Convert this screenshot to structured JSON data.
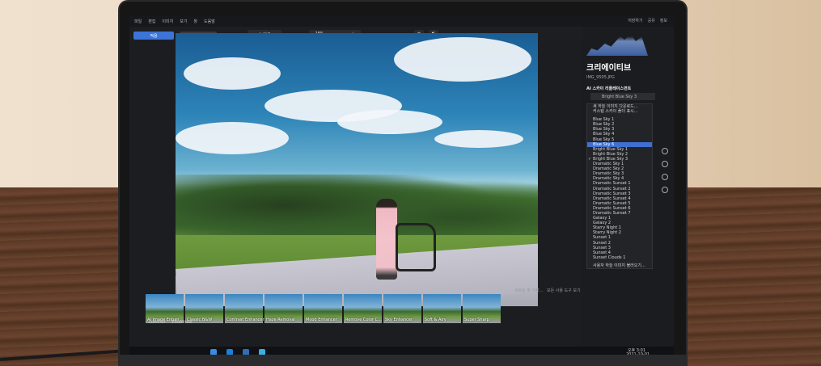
{
  "menu": [
    "파일",
    "편집",
    "이미지",
    "보기",
    "창",
    "도움말"
  ],
  "window_buttons": [
    "저장하기",
    "공유",
    "정보"
  ],
  "toolbar": {
    "apply_label": "적용",
    "cancel_label": "취소",
    "compare_label": "⊕ 비교",
    "zoom_value": "28%",
    "zoom_minus": "−",
    "zoom_plus": "+"
  },
  "panel": {
    "title": "크리에이티브",
    "filename": "IMG_9505.JPG",
    "tool_title": "AI 스카이 리플레이스먼트",
    "dropdown_value": "Bright Blue Sky 3",
    "menu_items": [
      "새 하늘 이미지 다운로드...",
      "커스텀 스카이 폴더 표시..."
    ],
    "sky_options": [
      "Blue Sky 1",
      "Blue Sky 2",
      "Blue Sky 3",
      "Blue Sky 4",
      "Blue Sky 5",
      "Blue Sky 6",
      "Bright Blue Sky 1",
      "Bright Blue Sky 2",
      "Bright Blue Sky 3",
      "Dramatic Sky 1",
      "Dramatic Sky 2",
      "Dramatic Sky 3",
      "Dramatic Sky 4",
      "Dramatic Sunset 1",
      "Dramatic Sunset 2",
      "Dramatic Sunset 3",
      "Dramatic Sunset 4",
      "Dramatic Sunset 5",
      "Dramatic Sunset 6",
      "Dramatic Sunset 7",
      "Galaxy 1",
      "Galaxy 2",
      "Starry Night 1",
      "Starry Night 2",
      "Sunset 1",
      "Sunset 2",
      "Sunset 3",
      "Sunset 4",
      "Sunset Clouds 1"
    ],
    "selected_option": "Blue Sky 6",
    "checked_option": "Bright Blue Sky 3",
    "load_custom": "사용자 하늘 이미지 불러오기..."
  },
  "bottom": {
    "luminar_label": "Luminar",
    "essentials_label": "Essentials",
    "hint_left": "새로운 룩 저장...",
    "hint_right": "모든 사용 도구 보기",
    "looks": [
      "AI Image Enhan...",
      "Classic B&W",
      "Contrast Enhancer",
      "Haze Removal",
      "Mood Enhancer",
      "Remove Color C...",
      "Sky Enhancer",
      "Soft & Airy",
      "Super Sharp"
    ]
  },
  "taskbar": {
    "time": "오후 3:01",
    "date": "2021-10-01"
  },
  "colors": {
    "accent": "#3c74d8",
    "panel_bg": "#1b1c20",
    "selection": "#3f6fd0"
  }
}
